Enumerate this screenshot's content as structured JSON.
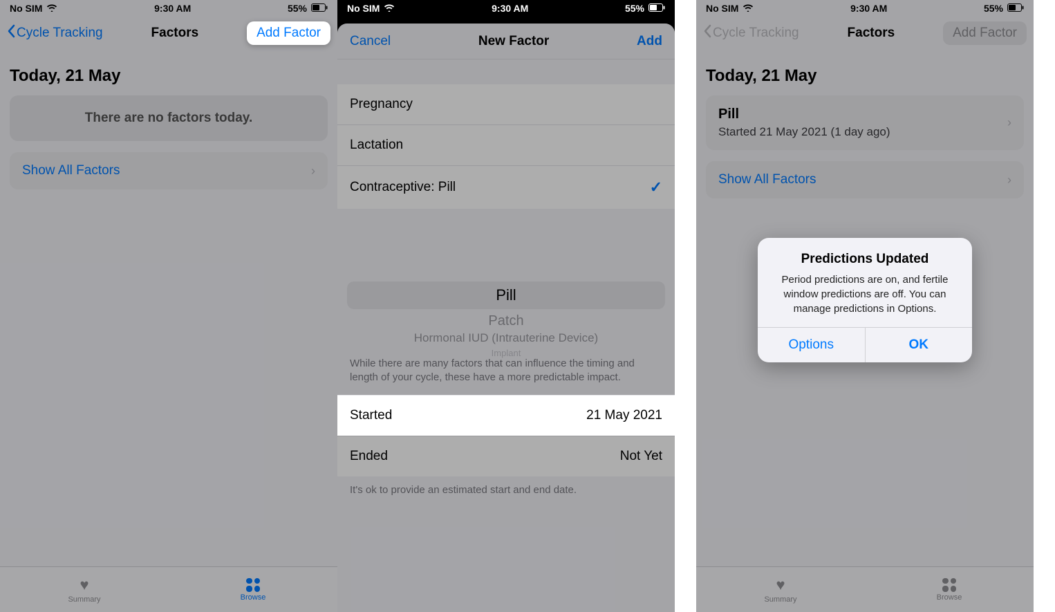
{
  "status": {
    "carrier": "No SIM",
    "time": "9:30 AM",
    "battery": "55%"
  },
  "screen1": {
    "back": "Cycle Tracking",
    "title": "Factors",
    "add": "Add Factor",
    "dateHeading": "Today, 21 May",
    "empty": "There are no factors today.",
    "showAll": "Show All Factors",
    "tabSummary": "Summary",
    "tabBrowse": "Browse"
  },
  "screen2": {
    "cancel": "Cancel",
    "title": "New Factor",
    "add": "Add",
    "options": {
      "pregnancy": "Pregnancy",
      "lactation": "Lactation",
      "contraceptivePill": "Contraceptive: Pill"
    },
    "picker": {
      "selected": "Pill",
      "below1": "Patch",
      "below2": "Hormonal IUD (Intrauterine Device)",
      "below3": "Implant"
    },
    "footerNote": "While there are many factors that can influence the timing and length of your cycle, these have a more predictable impact.",
    "startedLabel": "Started",
    "startedValue": "21 May 2021",
    "endedLabel": "Ended",
    "endedValue": "Not Yet",
    "endNote": "It's ok to provide an estimated start and end date."
  },
  "screen3": {
    "back": "Cycle Tracking",
    "title": "Factors",
    "add": "Add Factor",
    "dateHeading": "Today, 21 May",
    "pillTitle": "Pill",
    "pillSub": "Started 21 May 2021 (1 day ago)",
    "showAll": "Show All Factors",
    "alertTitle": "Predictions Updated",
    "alertMsg": "Period predictions are on, and fertile window predictions are off. You can manage predictions in Options.",
    "alertOptions": "Options",
    "alertOk": "OK",
    "tabSummary": "Summary",
    "tabBrowse": "Browse"
  }
}
